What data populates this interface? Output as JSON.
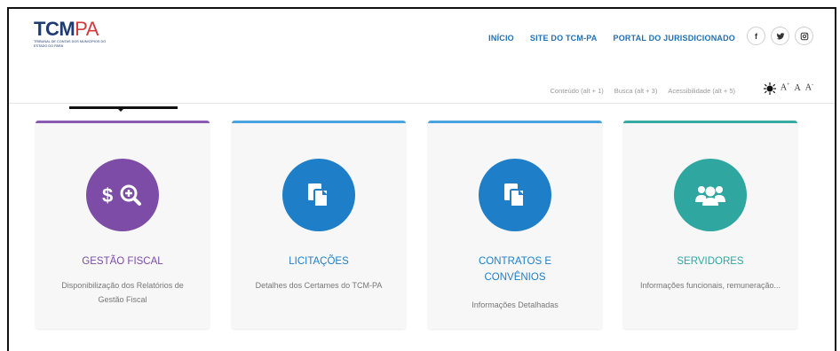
{
  "logo": {
    "main": "TCM",
    "suffix": "PA",
    "subtitle": "TRIBUNAL DE CONTAS DOS MUNICÍPIOS DO ESTADO DO PARÁ"
  },
  "nav": {
    "items": [
      {
        "label": "INÍCIO"
      },
      {
        "label": "SITE DO TCM-PA"
      },
      {
        "label": "PORTAL DO JURISDICIONADO"
      }
    ]
  },
  "social": {
    "facebook": "f",
    "twitter": "🐦",
    "instagram": "◘"
  },
  "subnav": {
    "items": [
      {
        "label": "Conteúdo (alt + 1)"
      },
      {
        "label": "Busca (alt + 3)"
      },
      {
        "label": "Acessibilidade (alt + 5)"
      }
    ]
  },
  "accessibility": {
    "increase": "A",
    "increase_sup": "+",
    "normal": "A",
    "decrease": "A",
    "decrease_sup": "-"
  },
  "cards": [
    {
      "title": "GESTÃO FISCAL",
      "description": "Disponibilização dos Relatórios de Gestão Fiscal",
      "icon": "dollar-search-icon",
      "color": "#7d4ca6"
    },
    {
      "title": "LICITAÇÕES",
      "description": "Detalhes dos Certames do TCM-PA",
      "icon": "documents-icon",
      "color": "#1e7fc8"
    },
    {
      "title": "CONTRATOS E CONVÊNIOS",
      "description": "Informações Detalhadas",
      "icon": "documents-icon",
      "color": "#1e7fc8"
    },
    {
      "title": "SERVIDORES",
      "description": "Informações funcionais, remuneração...",
      "icon": "users-icon",
      "color": "#2fa7a0"
    }
  ],
  "colors": {
    "nav_link": "#1f6fb3",
    "card_bg": "#f7f7f7",
    "topline_blue": "#4aa3df",
    "topline_purple": "#8a5bb3",
    "topline_teal": "#37aaa2"
  }
}
